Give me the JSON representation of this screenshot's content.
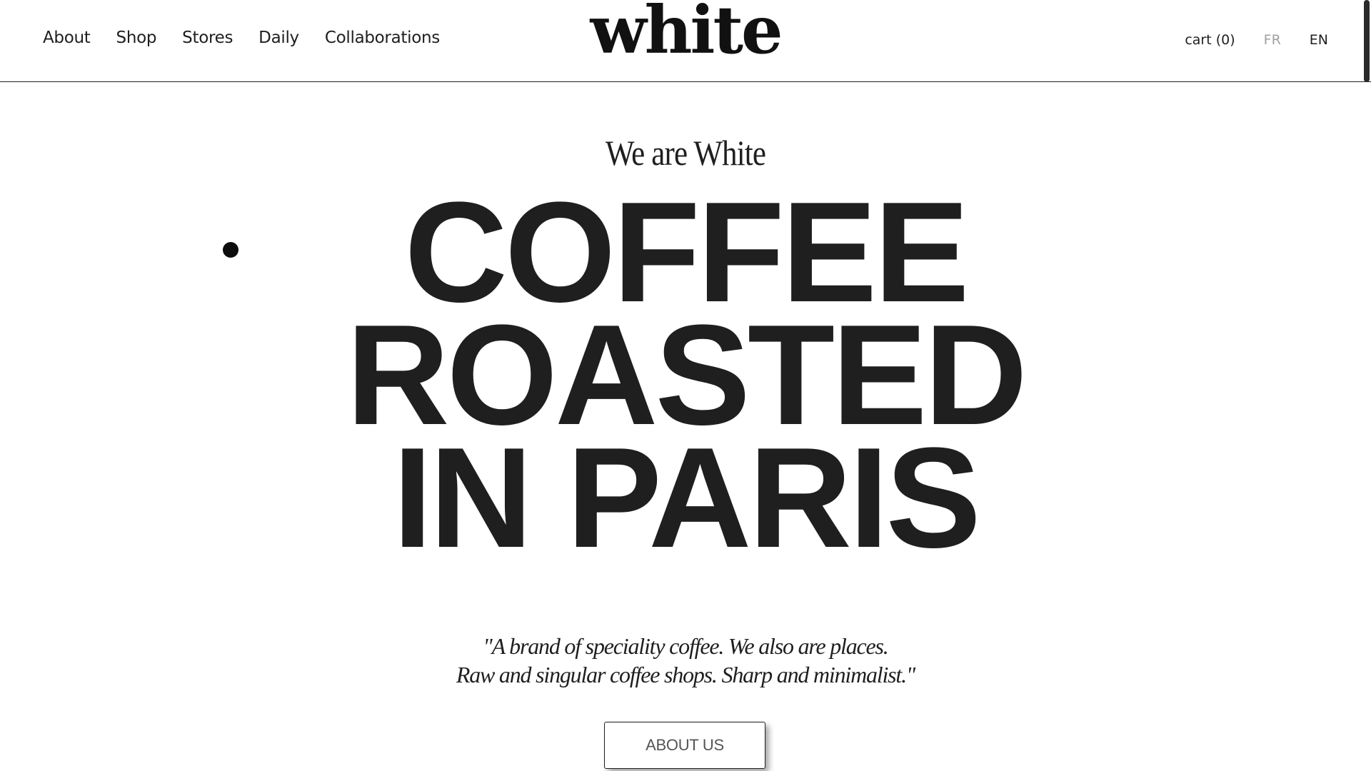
{
  "header": {
    "nav": [
      {
        "label": "About"
      },
      {
        "label": "Shop"
      },
      {
        "label": "Stores"
      },
      {
        "label": "Daily"
      },
      {
        "label": "Collaborations"
      }
    ],
    "logo": "white",
    "cart": "cart (0)",
    "languages": [
      {
        "label": "FR",
        "active": false
      },
      {
        "label": "EN",
        "active": true
      }
    ]
  },
  "hero": {
    "kicker": "We are White",
    "headline_lines": [
      "COFFEE",
      "ROASTED",
      "IN PARIS"
    ],
    "quote_lines": [
      "\"A brand of speciality coffee. We also are places.",
      "Raw and singular coffee shops. Sharp and minimalist.\""
    ],
    "cta": "ABOUT US"
  },
  "colors": {
    "text": "#1f1f1f",
    "background": "#ffffff",
    "inactive_language": "#a0a0a0"
  }
}
